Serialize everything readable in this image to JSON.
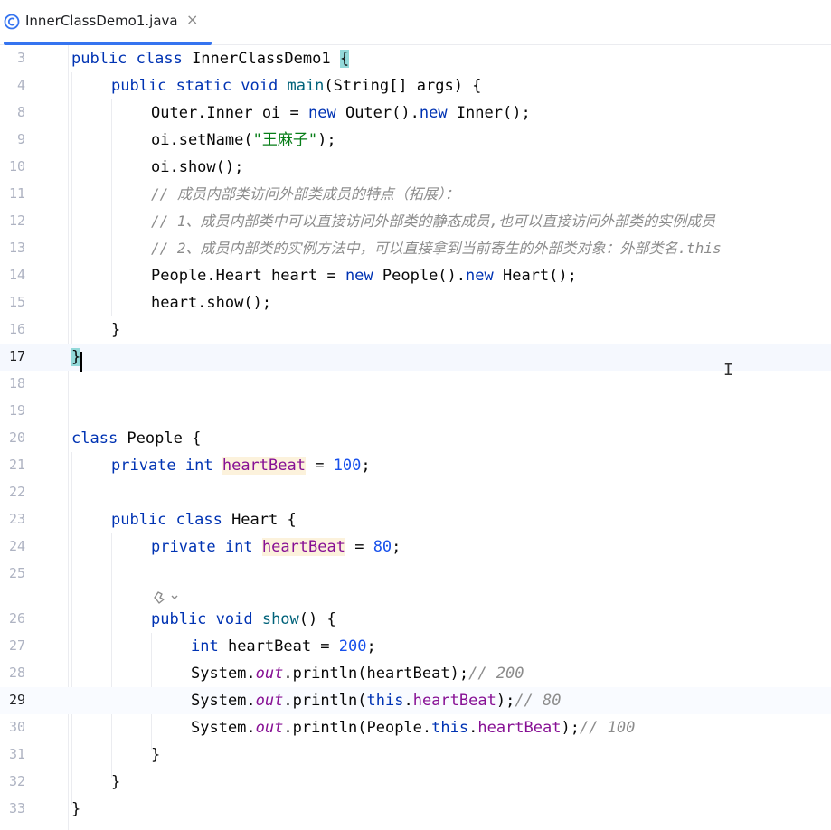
{
  "tab": {
    "label": "InnerClassDemo1.java",
    "close": "×"
  },
  "lines": [
    {
      "n": "3"
    },
    {
      "n": "4"
    },
    {
      "n": "8"
    },
    {
      "n": "9"
    },
    {
      "n": "10"
    },
    {
      "n": "11"
    },
    {
      "n": "12"
    },
    {
      "n": "13"
    },
    {
      "n": "14"
    },
    {
      "n": "15"
    },
    {
      "n": "16"
    },
    {
      "n": "17"
    },
    {
      "n": "18"
    },
    {
      "n": "19"
    },
    {
      "n": "20"
    },
    {
      "n": "21"
    },
    {
      "n": "22"
    },
    {
      "n": "23"
    },
    {
      "n": "24"
    },
    {
      "n": "25"
    },
    {
      "n": "26"
    },
    {
      "n": "27"
    },
    {
      "n": "28"
    },
    {
      "n": "29"
    },
    {
      "n": "30"
    },
    {
      "n": "31"
    },
    {
      "n": "32"
    },
    {
      "n": "33"
    }
  ],
  "code": {
    "l3": {
      "kw": "public class",
      "name": " InnerClassDemo1 ",
      "brace": "{"
    },
    "l4": {
      "kw": "public static void",
      "method": " main",
      "rest": "(String[] args) {"
    },
    "l8": {
      "a": "Outer.Inner oi = ",
      "new1": "new",
      "b": " Outer().",
      "new2": "new",
      "c": " Inner();"
    },
    "l9": {
      "a": "oi.setName(",
      "str": "\"王麻子\"",
      "b": ");"
    },
    "l10": {
      "a": "oi.show();"
    },
    "l11": {
      "cmt": "// 成员内部类访问外部类成员的特点（拓展）："
    },
    "l12": {
      "cmt": "// 1、成员内部类中可以直接访问外部类的静态成员,也可以直接访问外部类的实例成员"
    },
    "l13": {
      "cmt": "// 2、成员内部类的实例方法中，可以直接拿到当前寄生的外部类对象：外部类名.this"
    },
    "l14": {
      "a": "People.Heart heart = ",
      "new1": "new",
      "b": " People().",
      "new2": "new",
      "c": " Heart();"
    },
    "l15": {
      "a": "heart.show();"
    },
    "l16": {
      "a": "}"
    },
    "l17": {
      "a": "}"
    },
    "l20": {
      "kw": "class",
      "a": " People {"
    },
    "l21": {
      "kw": "private int",
      "sp": " ",
      "fld": "heartBeat",
      "a": " = ",
      "num": "100",
      "b": ";"
    },
    "l23": {
      "kw": "public class",
      "a": " Heart {"
    },
    "l24": {
      "kw": "private int",
      "sp": " ",
      "fld": "heartBeat",
      "a": " = ",
      "num": "80",
      "b": ";"
    },
    "l26": {
      "kw": "public void",
      "method": " show",
      "a": "() {"
    },
    "l27": {
      "kw": "int",
      "a": " heartBeat = ",
      "num": "200",
      "b": ";"
    },
    "l28": {
      "a": "System.",
      "stc": "out",
      "b": ".println(heartBeat);",
      "cmt": "// 200"
    },
    "l29": {
      "a": "System.",
      "stc": "out",
      "b": ".println(",
      "kw": "this",
      "c": ".",
      "fld": "heartBeat",
      "d": ");",
      "cmt": "// 80"
    },
    "l30": {
      "a": "System.",
      "stc": "out",
      "b": ".println(People.",
      "kw": "this",
      "c": ".",
      "fld": "heartBeat",
      "d": ");",
      "cmt": "// 100"
    },
    "l31": {
      "a": "}"
    },
    "l32": {
      "a": "}"
    },
    "l33": {
      "a": "}"
    }
  },
  "colors": {
    "keyword": "#0033b3",
    "string": "#067d17",
    "number": "#1750eb",
    "comment": "#8c8c8c",
    "field": "#871094",
    "method": "#00627a",
    "tab_accent": "#3574f0"
  },
  "icons": {
    "tab_icon": "java-class-icon",
    "hint_icon": "ai-assistant-icon",
    "cursor_icon": "text-cursor-icon"
  }
}
